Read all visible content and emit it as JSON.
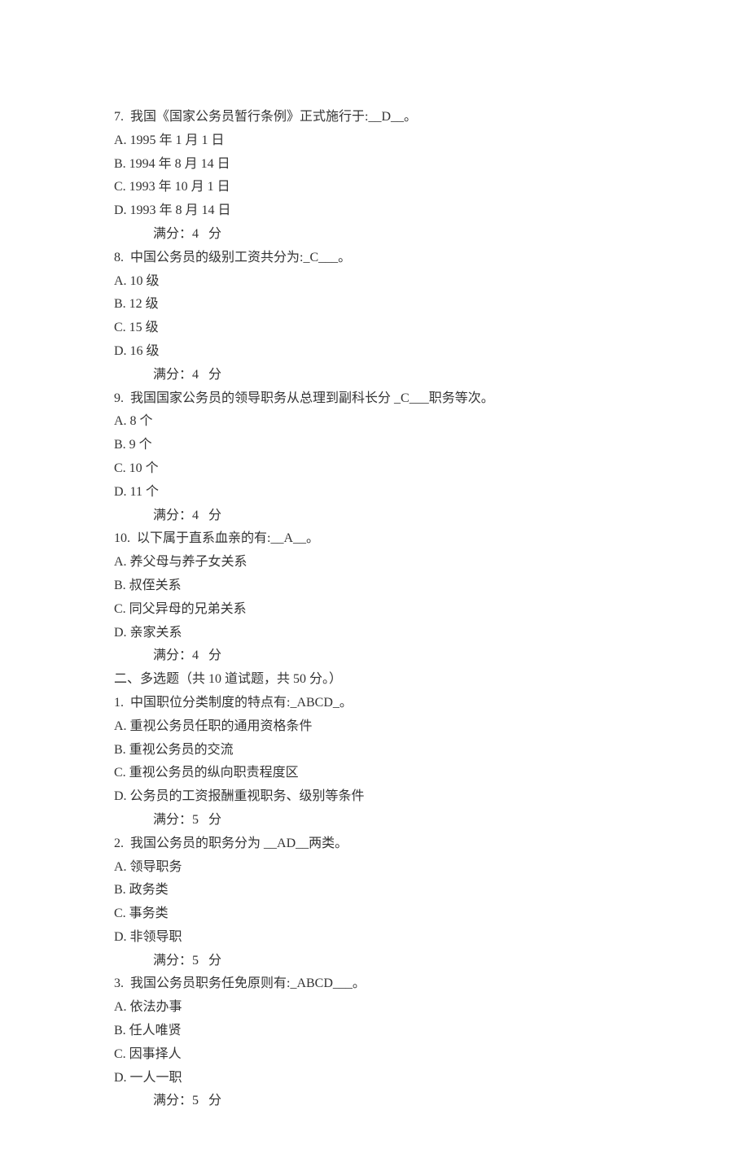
{
  "questions": [
    {
      "number": "7.",
      "text": "我国《国家公务员暂行条例》正式施行于:",
      "answer": "__D__",
      "suffix": "。",
      "options": [
        "A. 1995 年 1 月 1 日",
        "B. 1994 年 8 月 14 日",
        "C. 1993 年 10 月 1 日",
        "D. 1993 年 8 月 14 日"
      ],
      "score": "满分：4   分"
    },
    {
      "number": "8.",
      "text": "中国公务员的级别工资共分为:",
      "answer": "_C___",
      "suffix": "。",
      "options": [
        "A. 10 级",
        "B. 12 级",
        "C. 15 级",
        "D. 16 级"
      ],
      "score": "满分：4   分"
    },
    {
      "number": "9.",
      "text": "我国国家公务员的领导职务从总理到副科长分",
      "answer": " _C___",
      "suffix": "职务等次。",
      "options": [
        "A. 8 个",
        "B. 9 个",
        "C. 10 个",
        "D. 11 个"
      ],
      "score": "满分：4   分"
    },
    {
      "number": "10.",
      "text": "以下属于直系血亲的有:",
      "answer": "__A__",
      "suffix": "。",
      "options": [
        "A. 养父母与养子女关系",
        "B. 叔侄关系",
        "C. 同父异母的兄弟关系",
        "D. 亲家关系"
      ],
      "score": "满分：4   分"
    }
  ],
  "section_title": "二、多选题（共 10 道试题，共 50 分。）",
  "multi_questions": [
    {
      "number": "1.",
      "text": "中国职位分类制度的特点有:",
      "answer": "_ABCD_",
      "suffix": "。",
      "options": [
        "A. 重视公务员任职的通用资格条件",
        "B. 重视公务员的交流",
        "C. 重视公务员的纵向职责程度区",
        "D. 公务员的工资报酬重视职务、级别等条件"
      ],
      "score": "满分：5   分"
    },
    {
      "number": "2.",
      "text": "我国公务员的职务分为",
      "answer": " __AD__",
      "suffix": "两类。",
      "options": [
        "A. 领导职务",
        "B. 政务类",
        "C. 事务类",
        "D. 非领导职"
      ],
      "score": "满分：5   分"
    },
    {
      "number": "3.",
      "text": "我国公务员职务任免原则有:",
      "answer": "_ABCD___",
      "suffix": "。",
      "options": [
        "A. 依法办事",
        "B. 任人唯贤",
        "C. 因事择人",
        "D. 一人一职"
      ],
      "score": "满分：5   分"
    }
  ]
}
